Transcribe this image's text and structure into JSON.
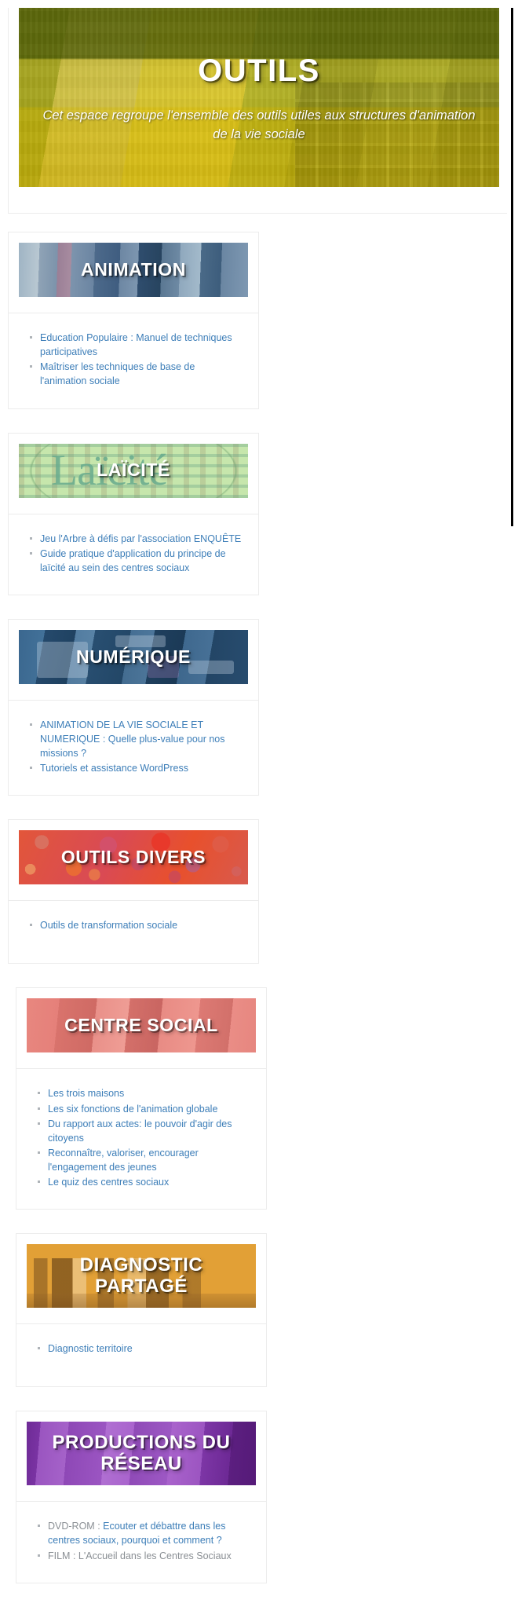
{
  "hero": {
    "title": "OUTILS",
    "subtitle": "Cet espace regroupe l'ensemble des outils utiles aux structures d'animation de la vie sociale"
  },
  "colors": {
    "link": "#3d7eb8",
    "muted_text": "#8a8f94",
    "card_border": "#ececec",
    "page_background": "#ffffff",
    "hero_accent": "#d9c83f",
    "animation_accent": "#3f5d80",
    "centre_social_accent": "#e2807a",
    "laicite_accent": "#c6e6ac",
    "diagnostic_accent": "#e2a036",
    "numerique_accent": "#34618a",
    "productions_accent": "#9a55c0",
    "outils_divers_accent": "#e04b28"
  },
  "cards": [
    {
      "id": "animation",
      "title": "ANIMATION",
      "banner_art": "conference-audience-photo",
      "items": [
        {
          "text": "Education Populaire : Manuel de techniques participatives",
          "link": true
        },
        {
          "text": "Maîtriser les techniques de base de l'animation sociale",
          "link": true
        }
      ]
    },
    {
      "id": "centre-social",
      "title": "CENTRE SOCIAL",
      "banner_art": "community-building-photo",
      "items": [
        {
          "text": "Les trois maisons",
          "link": true
        },
        {
          "text": "Les six fonctions de l'animation globale",
          "link": true
        },
        {
          "text": "Du rapport aux actes: le pouvoir d'agir des citoyens",
          "link": true
        },
        {
          "text": "Reconnaître, valoriser, encourager l'engagement des jeunes",
          "link": true
        },
        {
          "text": "Le quiz des centres sociaux",
          "link": true
        }
      ]
    },
    {
      "id": "laicite",
      "title": "LAÏCITÉ",
      "banner_art": "word-cloud-laicite",
      "items": [
        {
          "text": "Jeu l'Arbre à défis par l'association ENQUÊTE",
          "link": true
        },
        {
          "text": "Guide pratique d'application du principe de laïcité au sein des centres sociaux",
          "link": true
        }
      ]
    },
    {
      "id": "diagnostic-partage",
      "title": "DIAGNOSTIC PARTAGÉ",
      "banner_art": "city-skyline-illustration",
      "items": [
        {
          "text": "Diagnostic territoire",
          "link": true
        }
      ]
    },
    {
      "id": "numerique",
      "title": "NUMÉRIQUE",
      "banner_art": "digital-devices-photo",
      "items": [
        {
          "text": "ANIMATION DE LA VIE SOCIALE ET NUMERIQUE : Quelle plus-value pour nos missions ?",
          "link": true
        },
        {
          "text": "Tutoriels et assistance WordPress",
          "link": true
        }
      ]
    },
    {
      "id": "productions-du-reseau",
      "title": "PRODUCTIONS DU RÉSEAU",
      "banner_art": "purple-abstract-photo",
      "items": [
        {
          "prefix": "DVD-ROM : ",
          "text": "Ecouter et débattre dans les centres sociaux, pourquoi et comment ?",
          "link": true
        },
        {
          "text": "FILM : L'Accueil dans les Centres Sociaux",
          "link": false
        }
      ]
    },
    {
      "id": "outils-divers",
      "title": "OUTILS DIVERS",
      "banner_art": "gears-pattern-illustration",
      "items": [
        {
          "text": "Outils de transformation sociale",
          "link": true
        }
      ]
    }
  ]
}
